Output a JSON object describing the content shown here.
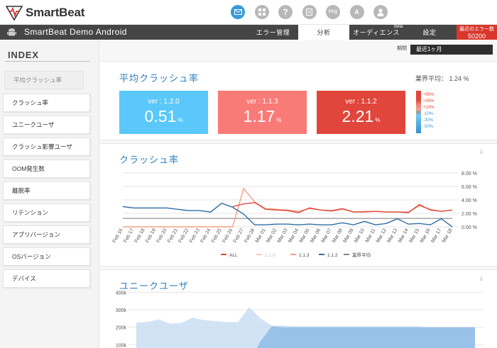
{
  "header": {
    "brand": "SmartBeat",
    "icons": [
      "mail-icon",
      "grid-icon",
      "help-icon",
      "list-icon",
      "faq-icon",
      "translate-icon",
      "user-icon"
    ],
    "faq_label": "FAQ"
  },
  "nav": {
    "app_name": "SmartBeat Demo Android",
    "tabs": [
      {
        "label": "エラー管理"
      },
      {
        "label": "分析"
      },
      {
        "label": "オーディエンス"
      },
      {
        "label": "設定"
      }
    ],
    "beta": "Beta",
    "recent_errors_label": "最近のエラー数",
    "recent_errors_value": "50200"
  },
  "sidebar": {
    "heading": "INDEX",
    "items": [
      {
        "label": "平均クラッシュ率"
      },
      {
        "label": "クラッシュ率"
      },
      {
        "label": "ユニークユーザ"
      },
      {
        "label": "クラッシュ影響ユーザ"
      },
      {
        "label": "OOM発生数"
      },
      {
        "label": "離脱率"
      },
      {
        "label": "リテンション"
      },
      {
        "label": "アプリバージョン"
      },
      {
        "label": "OSバージョン"
      },
      {
        "label": "デバイス"
      }
    ]
  },
  "period": {
    "label": "期間",
    "value": "最近1ヶ月"
  },
  "avg_crash": {
    "title": "平均クラッシュ率",
    "industry_avg": "業界平均：  1.24 %",
    "cards": [
      {
        "ver": "ver : 1.2.0",
        "value": "0.51",
        "unit": "%",
        "color": "#5ac8fa"
      },
      {
        "ver": "ver : 1.1.3",
        "value": "1.17",
        "unit": "%",
        "color": "#f97b78"
      },
      {
        "ver": "ver : 1.1.2",
        "value": "2.21",
        "unit": "%",
        "color": "#e0463b"
      }
    ],
    "scale": [
      {
        "label": "+50%",
        "color": "#e0463b"
      },
      {
        "label": "+30%",
        "color": "#e0463b"
      },
      {
        "label": "+10%",
        "color": "#e0463b"
      },
      {
        "label": "-10%",
        "color": "#3a9ad9"
      },
      {
        "label": "-30%",
        "color": "#3a9ad9"
      },
      {
        "label": "-50%",
        "color": "#3a9ad9"
      }
    ]
  },
  "crash_rate": {
    "title": "クラッシュ率"
  },
  "unique_users": {
    "title": "ユニークユーザ"
  },
  "chart_data": [
    {
      "type": "line",
      "x": [
        "Feb 16",
        "Feb 17",
        "Feb 18",
        "Feb 19",
        "Feb 20",
        "Feb 21",
        "Feb 22",
        "Feb 23",
        "Feb 24",
        "Feb 25",
        "Feb 26",
        "Feb 27",
        "Feb 28",
        "Mar 01",
        "Mar 02",
        "Mar 03",
        "Mar 04",
        "Mar 05",
        "Mar 06",
        "Mar 07",
        "Mar 08",
        "Mar 09",
        "Mar 10",
        "Mar 11",
        "Mar 12",
        "Mar 13",
        "Mar 14",
        "Mar 15",
        "Mar 16",
        "Mar 17",
        "Mar 18"
      ],
      "y_ticks": [
        "0.00 %",
        "2.00 %",
        "4.00 %",
        "6.00 %",
        "8.00 %"
      ],
      "ylim": [
        0,
        8
      ],
      "series": [
        {
          "name": "ALL",
          "color": "#e0463b",
          "values": [
            null,
            null,
            null,
            null,
            null,
            null,
            null,
            null,
            null,
            null,
            3.0,
            3.4,
            3.6,
            2.6,
            2.5,
            2.4,
            2.1,
            2.8,
            2.5,
            2.4,
            2.7,
            2.2,
            2.2,
            2.3,
            2.2,
            2.2,
            2.1,
            3.3,
            2.5,
            2.3,
            2.5
          ]
        },
        {
          "name": "1.2.0",
          "color": "#f3c9b8",
          "values": [
            null,
            null,
            null,
            null,
            null,
            null,
            null,
            null,
            null,
            null,
            null,
            null,
            null,
            null,
            null,
            null,
            null,
            null,
            null,
            null,
            null,
            null,
            null,
            null,
            null,
            null,
            null,
            null,
            null,
            null,
            null
          ]
        },
        {
          "name": "1.1.3",
          "color": "#f4a081",
          "values": [
            0.0,
            0.0,
            0.0,
            0.0,
            0.0,
            0.0,
            0.0,
            0.0,
            0.0,
            0.0,
            0.0,
            5.7,
            3.7,
            2.7,
            2.6,
            2.5,
            2.3,
            2.7,
            2.5,
            2.3,
            2.6,
            2.2,
            2.3,
            2.3,
            2.2,
            2.2,
            2.2,
            3.1,
            2.6,
            2.3,
            2.5
          ]
        },
        {
          "name": "1.1.2",
          "color": "#2e6da4",
          "values": [
            3.0,
            2.8,
            2.8,
            2.8,
            2.8,
            2.6,
            2.4,
            2.4,
            2.2,
            3.5,
            2.9,
            1.9,
            0.3,
            0.3,
            0.4,
            0.4,
            0.3,
            0.4,
            0.3,
            0.3,
            0.6,
            0.3,
            0.8,
            0.3,
            0.5,
            1.2,
            0.4,
            0.5,
            0.3,
            1.2,
            0.0
          ]
        },
        {
          "name": "業界平均",
          "color": "#888888",
          "values": [
            1.24,
            1.24,
            1.24,
            1.24,
            1.24,
            1.24,
            1.24,
            1.24,
            1.24,
            1.24,
            1.24,
            1.24,
            1.24,
            1.24,
            1.24,
            1.24,
            1.24,
            1.24,
            1.24,
            1.24,
            1.24,
            1.24,
            1.24,
            1.24,
            1.24,
            1.24,
            1.24,
            1.24,
            1.24,
            1.24,
            1.24
          ]
        }
      ]
    },
    {
      "type": "area",
      "y_ticks": [
        "100k",
        "200k",
        "300k",
        "400k"
      ],
      "ylim": [
        0,
        450000
      ],
      "series": [
        {
          "name": "ALL",
          "color": "#c9def3",
          "values": [
            225000,
            230000,
            245000,
            220000,
            225000,
            255000,
            240000,
            235000,
            230000,
            228000,
            315000,
            250000,
            210000,
            210000,
            205000,
            205000,
            205000,
            205000,
            205000,
            205000,
            205000,
            205000,
            205000,
            205000,
            205000,
            205000,
            200000,
            200000,
            200000,
            200000,
            200000
          ]
        },
        {
          "name": "1.1.3",
          "color": "#8fbce6",
          "values": [
            0,
            0,
            0,
            0,
            0,
            0,
            0,
            0,
            0,
            0,
            0,
            120000,
            205000,
            200000,
            200000,
            200000,
            200000,
            200000,
            200000,
            200000,
            200000,
            200000,
            200000,
            200000,
            200000,
            200000,
            200000,
            200000,
            200000,
            200000,
            200000
          ]
        }
      ]
    }
  ]
}
